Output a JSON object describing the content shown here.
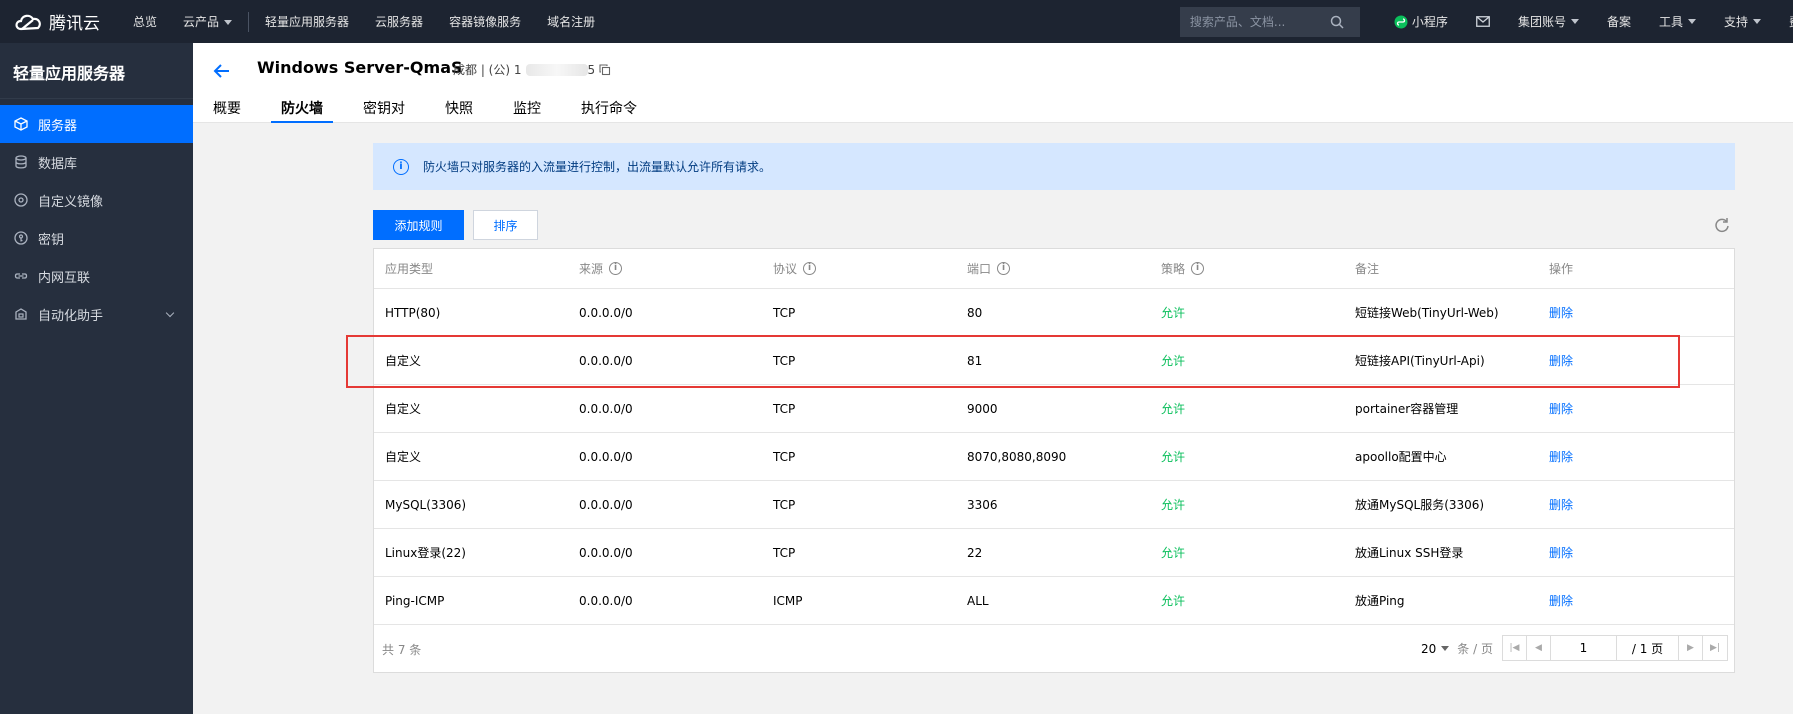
{
  "topbar": {
    "logo_text": "腾讯云",
    "nav": [
      "总览",
      "云产品",
      "轻量应用服务器",
      "云服务器",
      "容器镜像服务",
      "域名注册"
    ],
    "search_placeholder": "搜索产品、文档...",
    "miniprogram": "小程序",
    "group_account": "集团账号",
    "filing": "备案",
    "tools": "工具",
    "support": "支持",
    "cut_text": "费"
  },
  "sidebar": {
    "title": "轻量应用服务器",
    "items": [
      {
        "label": "服务器",
        "icon": "cube-icon"
      },
      {
        "label": "数据库",
        "icon": "database-icon"
      },
      {
        "label": "自定义镜像",
        "icon": "disc-icon"
      },
      {
        "label": "密钥",
        "icon": "key-icon"
      },
      {
        "label": "内网互联",
        "icon": "link-icon"
      },
      {
        "label": "自动化助手",
        "icon": "robot-icon"
      }
    ]
  },
  "header": {
    "title": "Windows Server-QmaS",
    "region": "成都 | (公) 1",
    "ip_tail": "5",
    "tabs": [
      "概要",
      "防火墙",
      "密钥对",
      "快照",
      "监控",
      "执行命令"
    ]
  },
  "info": {
    "text": "防火墙只对服务器的入流量进行控制，出流量默认允许所有请求。"
  },
  "buttons": {
    "add_rule": "添加规则",
    "sort": "排序"
  },
  "table": {
    "headers": [
      "应用类型",
      "来源",
      "协议",
      "端口",
      "策略",
      "备注",
      "操作"
    ],
    "rows": [
      {
        "type": "HTTP(80)",
        "source": "0.0.0.0/0",
        "protocol": "TCP",
        "port": "80",
        "policy": "允许",
        "note": "短链接Web(TinyUrl-Web)",
        "action": "删除"
      },
      {
        "type": "自定义",
        "source": "0.0.0.0/0",
        "protocol": "TCP",
        "port": "81",
        "policy": "允许",
        "note": "短链接API(TinyUrl-Api)",
        "action": "删除"
      },
      {
        "type": "自定义",
        "source": "0.0.0.0/0",
        "protocol": "TCP",
        "port": "9000",
        "policy": "允许",
        "note": "portainer容器管理",
        "action": "删除"
      },
      {
        "type": "自定义",
        "source": "0.0.0.0/0",
        "protocol": "TCP",
        "port": "8070,8080,8090",
        "policy": "允许",
        "note": "apoollo配置中心",
        "action": "删除"
      },
      {
        "type": "MySQL(3306)",
        "source": "0.0.0.0/0",
        "protocol": "TCP",
        "port": "3306",
        "policy": "允许",
        "note": "放通MySQL服务(3306)",
        "action": "删除"
      },
      {
        "type": "Linux登录(22)",
        "source": "0.0.0.0/0",
        "protocol": "TCP",
        "port": "22",
        "policy": "允许",
        "note": "放通Linux SSH登录",
        "action": "删除"
      },
      {
        "type": "Ping-ICMP",
        "source": "0.0.0.0/0",
        "protocol": "ICMP",
        "port": "ALL",
        "policy": "允许",
        "note": "放通Ping",
        "action": "删除"
      }
    ],
    "total": "共 7 条",
    "page_size": "20",
    "page_unit": "条 / 页",
    "page_current": "1",
    "page_total": "/ 1 页"
  },
  "colors": {
    "accent": "#006eff",
    "allow": "#0abf5b",
    "highlight": "#e53935",
    "topbar": "#1d2431",
    "sidebar": "#262f3e"
  }
}
